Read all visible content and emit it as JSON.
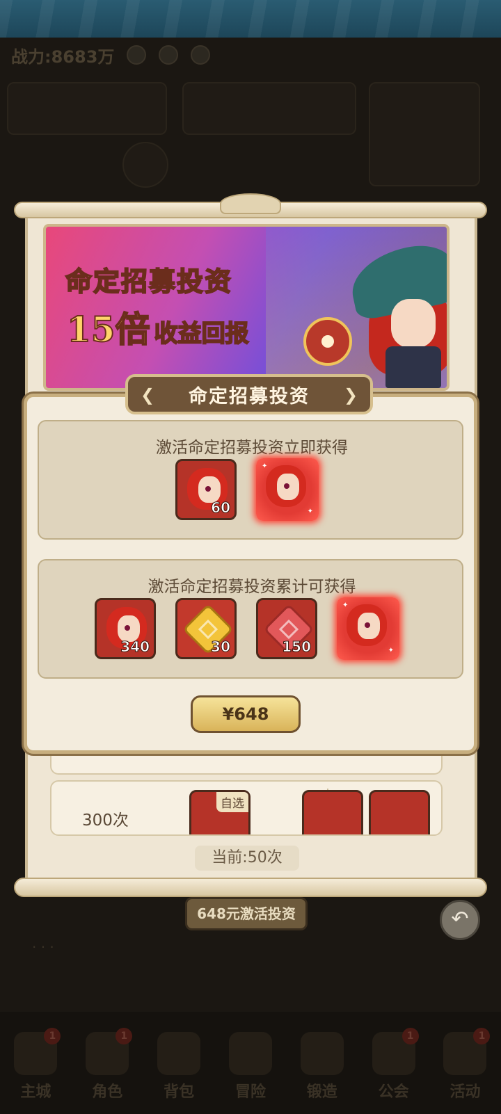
{
  "background": {
    "power_label": "战力:8683万"
  },
  "banner": {
    "line1": "命定招募投资",
    "line2_big": "15倍",
    "line2_small": "收益回报"
  },
  "modal": {
    "title": "命定招募投资",
    "section1_label": "激活命定招募投资立即获得",
    "section1_rewards": [
      {
        "kind": "hero-shard",
        "qty": "60"
      },
      {
        "kind": "hero-card",
        "qty": ""
      }
    ],
    "section2_label": "激活命定招募投资累计可获得",
    "section2_rewards": [
      {
        "kind": "hero-shard",
        "qty": "340"
      },
      {
        "kind": "gold-piece",
        "qty": "30"
      },
      {
        "kind": "red-piece",
        "qty": "150"
      },
      {
        "kind": "hero-card",
        "qty": ""
      }
    ],
    "price_label": "¥648"
  },
  "scroll": {
    "tier_count": "300次",
    "tier_tag": "自选",
    "current_label": "当前:50次"
  },
  "activate_button": "648元激活投资",
  "bottom_nav": [
    {
      "label": "主城",
      "badge": "1"
    },
    {
      "label": "角色",
      "badge": "1"
    },
    {
      "label": "背包",
      "badge": ""
    },
    {
      "label": "冒险",
      "badge": ""
    },
    {
      "label": "锻造",
      "badge": ""
    },
    {
      "label": "公会",
      "badge": "1"
    },
    {
      "label": "活动",
      "badge": "1"
    }
  ],
  "colors": {
    "modal_bg": "#f3ecdd",
    "plate": "#6f5438",
    "reward_red": "#b53328",
    "price_gold": "#d9b45a"
  }
}
